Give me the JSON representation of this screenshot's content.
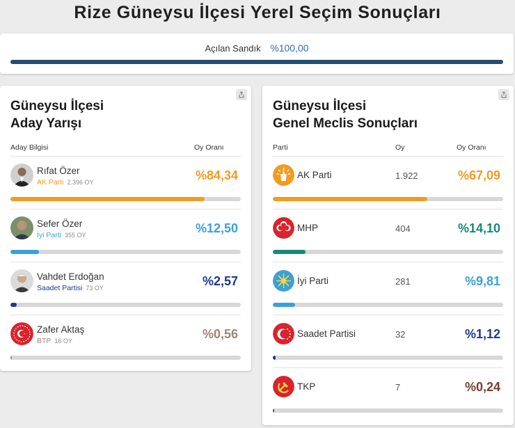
{
  "page": {
    "title": "Rize Güneysu İlçesi Yerel Seçim Sonuçları"
  },
  "ballot": {
    "label": "Açılan Sandık",
    "value": "%100,00",
    "percent": 100
  },
  "left_card": {
    "title_line1": "Güneysu İlçesi",
    "title_line2": "Aday Yarışı",
    "col_candidate": "Aday Bilgisi",
    "col_rate": "Oy Oranı",
    "candidates": [
      {
        "name": "Rıfat Özer",
        "party": "AK Parti",
        "votes": "2.396 OY",
        "pct": "%84,34",
        "value": 84.34,
        "color": "#f39b1f"
      },
      {
        "name": "Sefer Özer",
        "party": "İyi Parti",
        "votes": "355 OY",
        "pct": "%12,50",
        "value": 12.5,
        "color": "#3aa1d8"
      },
      {
        "name": "Vahdet Erdoğan",
        "party": "Saadet Partisi",
        "votes": "73 OY",
        "pct": "%2,57",
        "value": 2.57,
        "color": "#1c3a8c"
      },
      {
        "name": "Zafer Aktaş",
        "party": "BTP",
        "votes": "16 OY",
        "pct": "%0,56",
        "value": 0.56,
        "color": "#a08672"
      }
    ]
  },
  "right_card": {
    "title_line1": "Güneysu İlçesi",
    "title_line2": "Genel Meclis Sonuçları",
    "col_party": "Parti",
    "col_votes": "Oy",
    "col_rate": "Oy Oranı",
    "parties": [
      {
        "name": "AK Parti",
        "votes": "1.922",
        "pct": "%67,09",
        "value": 67.09,
        "color": "#f39b1f"
      },
      {
        "name": "MHP",
        "votes": "404",
        "pct": "%14,10",
        "value": 14.1,
        "color": "#168a74"
      },
      {
        "name": "İyi Parti",
        "votes": "281",
        "pct": "%9,81",
        "value": 9.81,
        "color": "#3aa1d8"
      },
      {
        "name": "Saadet Partisi",
        "votes": "32",
        "pct": "%1,12",
        "value": 1.12,
        "color": "#1c3a8c"
      },
      {
        "name": "TKP",
        "votes": "7",
        "pct": "%0,24",
        "value": 0.24,
        "color": "#7a3e2d"
      }
    ]
  },
  "icons": {
    "share": "share-icon",
    "logos": [
      "akp-logo-icon",
      "mhp-logo-icon",
      "iyi-logo-icon",
      "saadet-logo-icon",
      "tkp-logo-icon",
      "btp-logo-icon"
    ]
  }
}
